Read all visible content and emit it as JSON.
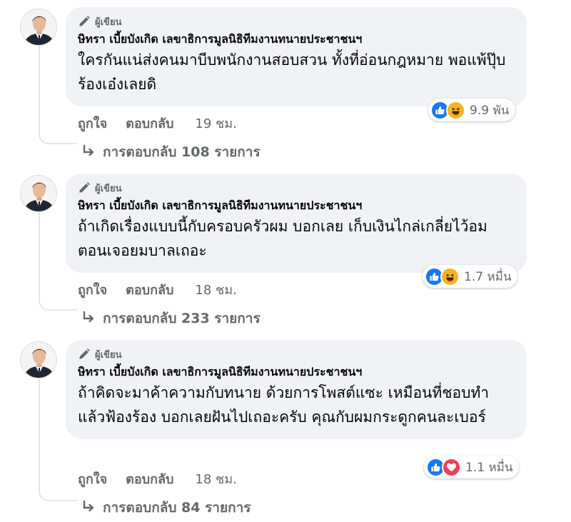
{
  "comments": [
    {
      "role_label": "ผู้เขียน",
      "author": "ษิทรา เบี้ยบังเกิด เลขาธิการมูลนิธิทีมงานทนายประชาชนฯ",
      "text": "ใครกันแน่ส่งคนมาบีบพนักงานสอบสวน ทั้งที่อ่อนกฎหมาย พอแพ้ปุ๊บ ร้องเอ๋งเลยดิ",
      "reactions": [
        "like-icon",
        "haha-icon"
      ],
      "reaction_count": "9.9 พัน",
      "like_label": "ถูกใจ",
      "reply_label": "ตอบกลับ",
      "time": "19 ชม.",
      "replies_label": "การตอบกลับ 108 รายการ"
    },
    {
      "role_label": "ผู้เขียน",
      "author": "ษิทรา เบี้ยบังเกิด เลขาธิการมูลนิธิทีมงานทนายประชาชนฯ",
      "text": "ถ้าเกิดเรื่องแบบนี้กับครอบครัวผม บอกเลย เก็บเงินไกล่เกลี่ยไว้อมตอนเจอยมบาลเถอะ",
      "reactions": [
        "like-icon",
        "haha-icon"
      ],
      "reaction_count": "1.7 หมื่น",
      "like_label": "ถูกใจ",
      "reply_label": "ตอบกลับ",
      "time": "18 ชม.",
      "replies_label": "การตอบกลับ 233 รายการ"
    },
    {
      "role_label": "ผู้เขียน",
      "author": "ษิทรา เบี้ยบังเกิด เลขาธิการมูลนิธิทีมงานทนายประชาชนฯ",
      "text": "ถ้าคิดจะมาค้าความกับทนาย ด้วยการโพสต์แซะ เหมือนที่ชอบทำ แล้วฟ้องร้อง บอกเลยฝันไปเถอะครับ คุณกับผมกระดูกคนละเบอร์",
      "reactions": [
        "like-icon",
        "love-icon"
      ],
      "reaction_count": "1.1 หมื่น",
      "like_label": "ถูกใจ",
      "reply_label": "ตอบกลับ",
      "time": "18 ชม.",
      "replies_label": "การตอบกลับ 84 รายการ"
    }
  ],
  "colors": {
    "bubble": "#f0f2f5",
    "secondary_text": "#65676b",
    "like": "#1877f2",
    "haha": "#f7b125",
    "love": "#f33e58"
  }
}
